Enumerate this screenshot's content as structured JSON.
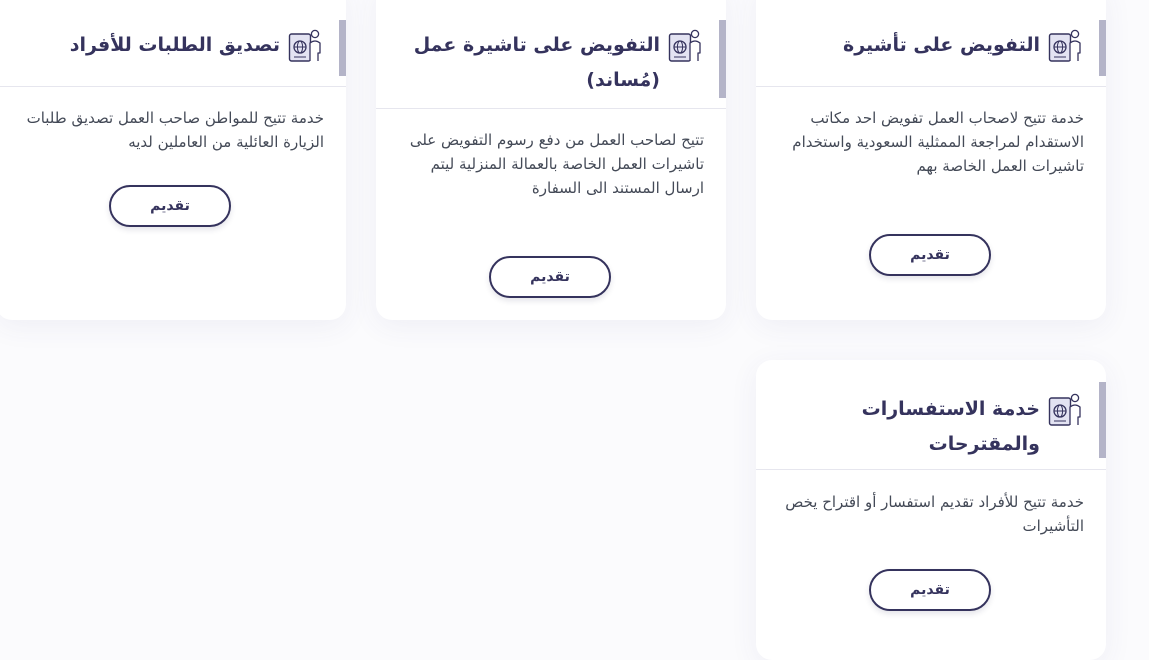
{
  "cards": [
    {
      "title": "التفويض على تأشيرة",
      "description": "خدمة تتيح لاصحاب العمل تفويض احد مكاتب الاستقدام لمراجعة الممثلية السعودية واستخدام تاشيرات العمل الخاصة بهم",
      "button_label": "تقديم",
      "icon": "passport-person-icon"
    },
    {
      "title": "التفويض على تاشيرة عمل (مُساند)",
      "description": "تتيح لصاحب العمل من دفع رسوم التفويض على تاشيرات العمل الخاصة بالعمالة المنزلية ليتم ارسال المستند الى السفارة",
      "button_label": "تقديم",
      "icon": "passport-person-icon"
    },
    {
      "title": "تصديق الطلبات للأفراد",
      "description": "خدمة تتيح للمواطن صاحب العمل تصديق طلبات الزيارة العائلية من العاملين لديه",
      "button_label": "تقديم",
      "icon": "passport-person-icon"
    },
    {
      "title": "خدمة الاستفسارات والمقترحات",
      "description": "خدمة تتيح للأفراد تقديم استفسار أو اقتراح يخص التأشيرات",
      "button_label": "تقديم",
      "icon": "passport-person-icon"
    }
  ],
  "colors": {
    "title": "#35335d",
    "accent_bar": "#b4b4c8",
    "text": "#444a57",
    "card_bg": "#ffffff",
    "page_bg": "#fbfbfd"
  }
}
